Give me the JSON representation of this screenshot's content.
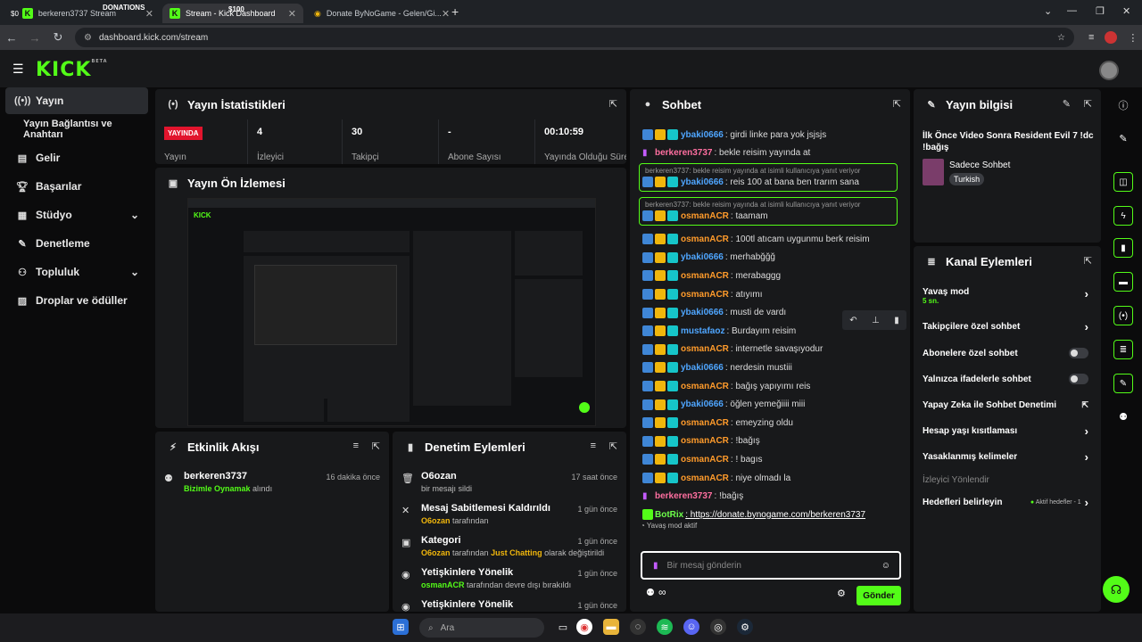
{
  "browser": {
    "tabs": [
      {
        "label": "berkeren3737 Stream",
        "overlay": "DONATIONS",
        "amount": "$0"
      },
      {
        "label": "Stream - Kick Dashboard",
        "amount": "$100"
      },
      {
        "label": "Donate ByNoGame - Gelen/Gi..."
      }
    ],
    "url": "dashboard.kick.com/stream"
  },
  "app": {
    "logo": "KICK",
    "logo_badge": "BETA"
  },
  "sidebar": {
    "items": [
      {
        "label": "Yayın",
        "icon": "broadcast-icon"
      },
      {
        "label": "Yayın Bağlantısı ve Anahtarı",
        "icon": ""
      },
      {
        "label": "Gelir",
        "icon": "wallet-icon"
      },
      {
        "label": "Başarılar",
        "icon": "trophy-icon"
      },
      {
        "label": "Stüdyo",
        "icon": "studio-icon"
      },
      {
        "label": "Denetleme",
        "icon": "wrench-icon"
      },
      {
        "label": "Topluluk",
        "icon": "community-icon"
      },
      {
        "label": "Droplar ve ödüller",
        "icon": "gift-icon"
      }
    ]
  },
  "stats": {
    "title": "Yayın İstatistikleri",
    "live_badge": "YAYINDA",
    "cols": [
      {
        "value": "",
        "label": "Yayın"
      },
      {
        "value": "4",
        "label": "İzleyici"
      },
      {
        "value": "30",
        "label": "Takipçi"
      },
      {
        "value": "-",
        "label": "Abone Sayısı"
      },
      {
        "value": "00:10:59",
        "label": "Yayında Olduğu Süre"
      }
    ]
  },
  "preview": {
    "title": "Yayın Ön İzlemesi"
  },
  "activity": {
    "title": "Etkinlik Akışı",
    "items": [
      {
        "user": "berkeren3737",
        "game": "Bizimle Oynamak",
        "action": "alındı",
        "time": "16 dakika önce"
      }
    ]
  },
  "modlog": {
    "title": "Denetim Eylemleri",
    "items": [
      {
        "title": "O6ozan",
        "sub_a": "bir mesajı sildi",
        "time": "17 saat önce"
      },
      {
        "title": "Mesaj Sabitlemesi Kaldırıldı",
        "user": "O6ozan",
        "sub_a": "tarafından",
        "time": "1 gün önce"
      },
      {
        "title": "Kategori",
        "user": "O6ozan",
        "sub_a": "tarafından",
        "cat": "Just Chatting",
        "sub_b": "olarak değiştirildi",
        "time": "1 gün önce"
      },
      {
        "title": "Yetişkinlere Yönelik",
        "user": "osmanACR",
        "sub_a": "tarafından devre dışı bırakıldı",
        "time": "1 gün önce"
      },
      {
        "title": "Yetişkinlere Yönelik",
        "time": "1 gün önce"
      }
    ]
  },
  "chat": {
    "title": "Sohbet",
    "messages": [
      {
        "user": "ybaki0666",
        "text": ": girdi linke para yok jsjsjs",
        "color": "blue"
      },
      {
        "user": "berkeren3737",
        "text": ": bekle reisim yayında at",
        "color": "pink",
        "broadcaster": true
      },
      {
        "reply_to": "berkeren3737: bekle reisim yayında at isimli kullanıcıya yanıt veriyor",
        "user": "ybaki0666",
        "text": ": reis 100 at bana ben trarım sana",
        "color": "blue"
      },
      {
        "reply_to": "berkeren3737: bekle reisim yayında at isimli kullanıcıya yanıt veriyor",
        "user": "osmanACR",
        "text": ": taamam",
        "color": "orange"
      },
      {
        "user": "osmanACR",
        "text": ": 100tl atıcam uygunmu berk reisim",
        "color": "orange"
      },
      {
        "user": "ybaki0666",
        "text": ": merhabğğğ",
        "color": "blue"
      },
      {
        "user": "osmanACR",
        "text": ": merabaggg",
        "color": "orange"
      },
      {
        "user": "osmanACR",
        "text": ": atıyımı",
        "color": "orange"
      },
      {
        "user": "ybaki0666",
        "text": ": musti de vardı",
        "color": "blue"
      },
      {
        "user": "mustafaoz",
        "text": ": Burdayım reisim",
        "color": "blue"
      },
      {
        "user": "osmanACR",
        "text": ": internetle savaşıyodur",
        "color": "orange"
      },
      {
        "user": "ybaki0666",
        "text": ": nerdesin mustiii",
        "color": "blue"
      },
      {
        "user": "osmanACR",
        "text": ": bağış yapıyımı reis",
        "color": "orange"
      },
      {
        "user": "ybaki0666",
        "text": ": öğlen yemeğiiii miii",
        "color": "blue"
      },
      {
        "user": "osmanACR",
        "text": ": emeyzing oldu",
        "color": "orange"
      },
      {
        "user": "osmanACR",
        "text": ": !bağış",
        "color": "orange"
      },
      {
        "user": "osmanACR",
        "text": ": ! bagıs",
        "color": "orange"
      },
      {
        "user": "osmanACR",
        "text": ": niye olmadı la",
        "color": "orange"
      },
      {
        "user": "berkeren3737",
        "text": ": !bağış",
        "color": "pink",
        "broadcaster": true
      },
      {
        "user": "BotRix",
        "text": ": https://donate.bynogame.com/berkeren3737",
        "color": "lime",
        "bot": true
      }
    ],
    "slow_mode": "Yavaş mod aktif",
    "input_placeholder": "Bir mesaj gönderin",
    "send_label": "Gönder",
    "infinity": "∞"
  },
  "streaminfo": {
    "title": "Yayın bilgisi",
    "stream_title": "İlk Önce Video Sonra Resident Evil 7 !dc !bağış",
    "category": "Sadece Sohbet",
    "language": "Turkish"
  },
  "channel_actions": {
    "title": "Kanal Eylemleri",
    "slow_mode": {
      "label": "Yavaş mod",
      "value": "5 sn."
    },
    "followers_only": "Takipçilere özel sohbet",
    "subscribers_only": "Abonelere özel sohbet",
    "emotes_only": "Yalnızca ifadelerle sohbet",
    "ai_moderation": "Yapay Zeka ile Sohbet Denetimi",
    "age_restriction": "Hesap yaşı kısıtlaması",
    "banned_words": "Yasaklanmış kelimeler",
    "raid_heading": "İzleyici Yönlendir",
    "targets": {
      "label": "Hedefleri belirleyin",
      "status": "Aktif hedefler - 1"
    }
  },
  "taskbar": {
    "search_placeholder": "Ara"
  },
  "colors": {
    "accent": "#53fc18",
    "live": "#e2142d",
    "panel": "#18191b"
  }
}
